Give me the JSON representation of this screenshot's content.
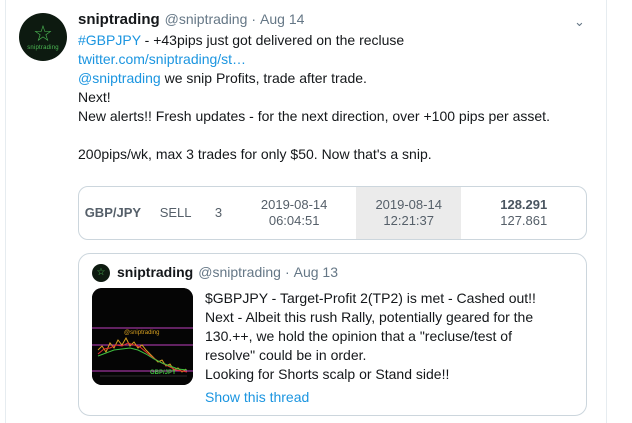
{
  "tweet": {
    "avatar_text": "sniptrading",
    "name": "sniptrading",
    "handle": "@sniptrading",
    "separator": "·",
    "date": "Aug 14",
    "caret": "⌄",
    "lines": {
      "l1_tag": "#GBPJPY",
      "l1_rest": " - +43pips just got delivered on the recluse",
      "l2_link": "twitter.com/sniptrading/st…",
      "l3_mention": "@sniptrading",
      "l3_rest": " we snip Profits, trade after trade.",
      "l4": "Next!",
      "l5": "New alerts!! Fresh updates - for the next direction, over +100 pips per asset.",
      "l6": "200pips/wk, max 3 trades for only $50. Now that's a snip."
    }
  },
  "card": {
    "pair": "GBP/JPY",
    "side": "SELL",
    "qty": "3",
    "open_date": "2019-08-14",
    "open_time": "06:04:51",
    "close_date": "2019-08-14",
    "close_time": "12:21:37",
    "price_1": "128.291",
    "price_2": "127.861"
  },
  "quote": {
    "name": "sniptrading",
    "handle": "@sniptrading",
    "separator": "·",
    "date": "Aug 13",
    "thumb_label": "@sniptrading",
    "thumb_pair": "GBP/JPY",
    "text": {
      "q1": "$GBPJPY - Target-Profit 2(TP2) is met - Cashed out!!",
      "q2": " Next - Albeit this rush Rally, potentially geared for the",
      "q3": "130.++, we hold the opinion that a \"recluse/test of",
      "q4": "resolve\" could be in order.",
      "q5": " Looking for Shorts scalp or Stand side!!"
    },
    "show_thread": "Show this thread"
  },
  "colors": {
    "link": "#1b95e0",
    "muted": "#657786",
    "border": "#ccd6dd",
    "brand_green": "#4dbb55"
  }
}
